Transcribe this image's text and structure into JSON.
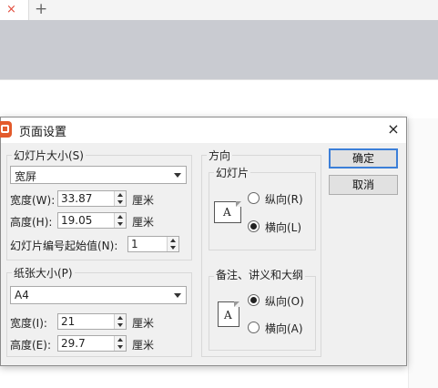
{
  "tabs": {
    "close_glyph": "×",
    "add_glyph": "+"
  },
  "dialog": {
    "title": "页面设置",
    "close_glyph": "×",
    "slide_size": {
      "group_label": "幻灯片大小(S)",
      "preset_value": "宽屏",
      "width_label": "宽度(W):",
      "width_value": "33.87",
      "width_unit": "厘米",
      "height_label": "高度(H):",
      "height_value": "19.05",
      "height_unit": "厘米",
      "start_number_label": "幻灯片编号起始值(N):",
      "start_number_value": "1"
    },
    "paper_size": {
      "group_label": "纸张大小(P)",
      "preset_value": "A4",
      "width_label": "宽度(I):",
      "width_value": "21",
      "width_unit": "厘米",
      "height_label": "高度(E):",
      "height_value": "29.7",
      "height_unit": "厘米"
    },
    "orientation": {
      "group_label": "方向",
      "slides": {
        "label": "幻灯片",
        "icon_letter": "A",
        "portrait": "纵向(R)",
        "landscape": "横向(L)",
        "selected": "landscape"
      },
      "notes": {
        "label": "备注、讲义和大纲",
        "icon_letter": "A",
        "portrait": "纵向(O)",
        "landscape": "横向(A)",
        "selected": "portrait"
      }
    },
    "buttons": {
      "ok": "确定",
      "cancel": "取消"
    }
  }
}
